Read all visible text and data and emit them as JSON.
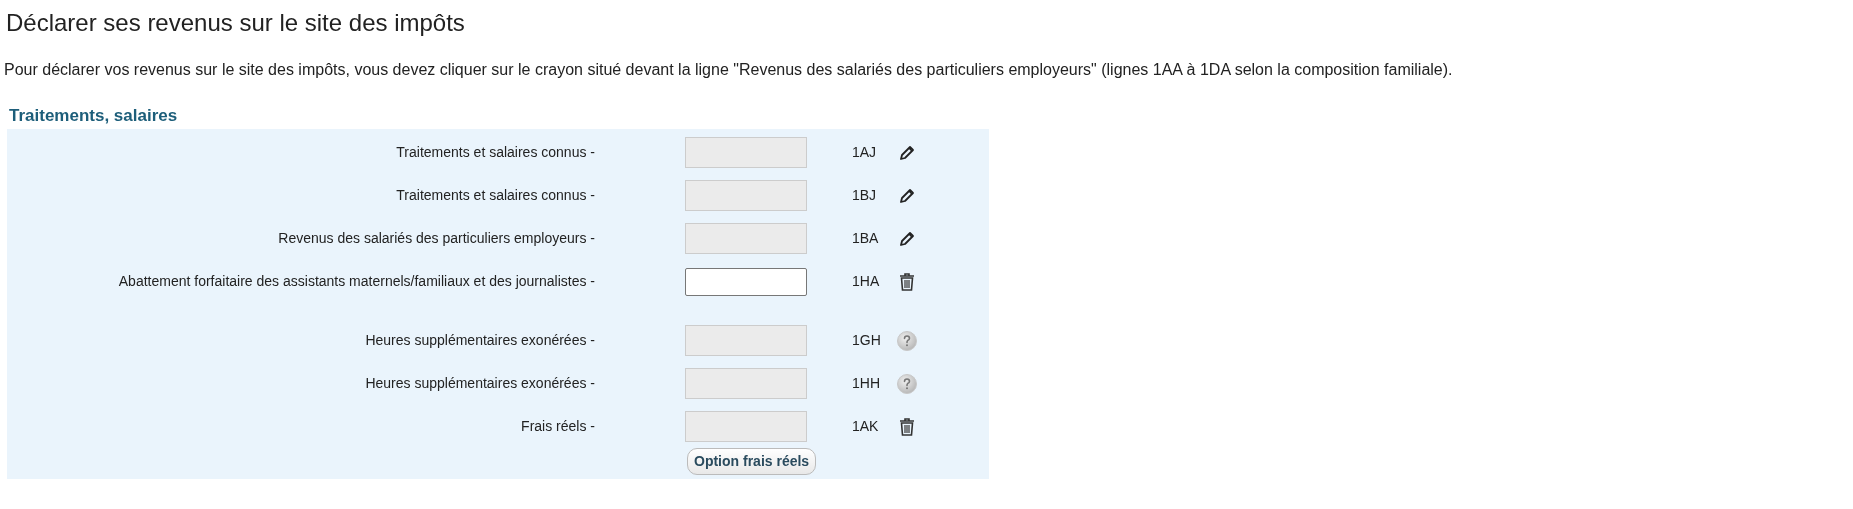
{
  "title": "Déclarer ses revenus sur le site des impôts",
  "intro": "Pour déclarer vos revenus sur le site des impôts, vous devez cliquer sur le crayon situé devant la ligne \"Revenus des salariés des particuliers employeurs\" (lignes 1AA à 1DA selon la composition familiale).",
  "section": {
    "title": "Traitements, salaires",
    "groups": [
      [
        {
          "label": "Traitements et salaires connus -",
          "disabled": true,
          "code": "1AJ",
          "kind": "edit"
        },
        {
          "label": "Traitements et salaires connus -",
          "disabled": true,
          "code": "1BJ",
          "kind": "edit"
        },
        {
          "label": "Revenus des salariés des particuliers employeurs -",
          "disabled": true,
          "code": "1BA",
          "kind": "edit"
        },
        {
          "label": "Abattement forfaitaire des assistants maternels/familiaux et des journalistes -",
          "disabled": false,
          "code": "1HA",
          "kind": "delete"
        }
      ],
      [
        {
          "label": "Heures supplémentaires exonérées -",
          "disabled": true,
          "code": "1GH",
          "kind": "help"
        },
        {
          "label": "Heures supplémentaires exonérées -",
          "disabled": true,
          "code": "1HH",
          "kind": "help"
        },
        {
          "label": "Frais réels -",
          "disabled": true,
          "code": "1AK",
          "kind": "delete"
        }
      ]
    ],
    "button": "Option frais réels"
  }
}
